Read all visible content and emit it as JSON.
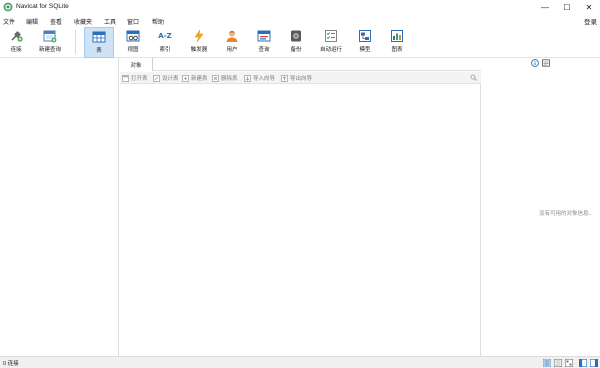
{
  "window": {
    "title": "Navicat for SQLite",
    "minimize_glyph": "—",
    "maximize_glyph": "☐",
    "close_glyph": "✕"
  },
  "menu": {
    "items": [
      "文件",
      "编辑",
      "查看",
      "收藏夹",
      "工具",
      "窗口",
      "帮助"
    ],
    "login": "登录"
  },
  "toolbar": {
    "items": [
      {
        "label": "连接",
        "icon": "plug-icon"
      },
      {
        "label": "新建查询",
        "icon": "new-query-icon"
      },
      {
        "label": "表",
        "icon": "table-icon",
        "active": true
      },
      {
        "label": "视图",
        "icon": "view-icon"
      },
      {
        "label": "索引",
        "icon": "index-icon",
        "glyph": "A-Z"
      },
      {
        "label": "触发器",
        "icon": "trigger-icon"
      },
      {
        "label": "用户",
        "icon": "user-icon"
      },
      {
        "label": "查询",
        "icon": "query-icon"
      },
      {
        "label": "备份",
        "icon": "backup-icon"
      },
      {
        "label": "自动运行",
        "icon": "automation-icon"
      },
      {
        "label": "模型",
        "icon": "model-icon"
      },
      {
        "label": "图表",
        "icon": "chart-icon"
      }
    ]
  },
  "tabs": {
    "objects": "对象"
  },
  "object_toolbar": {
    "items": [
      {
        "label": "打开表",
        "icon": "open-table-icon"
      },
      {
        "label": "设计表",
        "icon": "design-table-icon"
      },
      {
        "label": "新建表",
        "icon": "new-table-icon"
      },
      {
        "label": "删除表",
        "icon": "delete-table-icon"
      },
      {
        "label": "导入向导",
        "icon": "import-wizard-icon"
      },
      {
        "label": "导出向导",
        "icon": "export-wizard-icon"
      }
    ]
  },
  "right_panel": {
    "empty_message": "没有可用的对象信息。"
  },
  "status": {
    "connections": "0 连接"
  },
  "colors": {
    "active_tool_bg": "#cfe3f6",
    "accent_blue": "#2a6fb8",
    "orange": "#e8862a",
    "red": "#d9473b"
  }
}
